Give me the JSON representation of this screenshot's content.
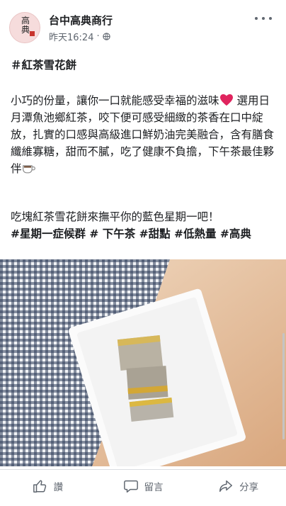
{
  "header": {
    "page_name": "台中高典商行",
    "timestamp": "昨天16:24",
    "separator": "·",
    "privacy_icon": "globe-icon",
    "more_icon": "more-icon",
    "avatar": {
      "logo_text_top": "高",
      "logo_text_bottom": "典"
    }
  },
  "post": {
    "title": "＃紅茶雪花餅",
    "line1": "小巧的份量，讓你一口就能感受幸福的滋味",
    "line1_icon": "heart-icon",
    "line2": "選用日月潭魚池鄉紅茶，咬下便可感受細緻的茶香在口中綻放，扎實的口感與高級進口鮮奶油完美融合，含有膳食纖維寡糖，甜而不膩，吃了健康不負擔，下午茶最佳夥伴",
    "line2_icon": "coffee-cup-icon",
    "line3": "吃塊紅茶雪花餅來撫平你的藍色星期一吧！",
    "hashtags": "#星期一症候群 # 下午茶 #甜點 #低熱量 #高典"
  },
  "photo": {
    "subject": "three snowflake crisps on a white rectangular plate over a gingham tablecloth"
  },
  "actions": {
    "like": {
      "label": "讚",
      "icon": "thumbs-up-icon"
    },
    "comment": {
      "label": "留言",
      "icon": "comment-bubble-icon"
    },
    "share": {
      "label": "分享",
      "icon": "share-arrow-icon"
    }
  },
  "colors": {
    "text": "#1c1e21",
    "secondary_text": "#606770",
    "heart": "#e0245e",
    "divider": "#dadde1",
    "avatar_bg": "#f6dcdc"
  }
}
